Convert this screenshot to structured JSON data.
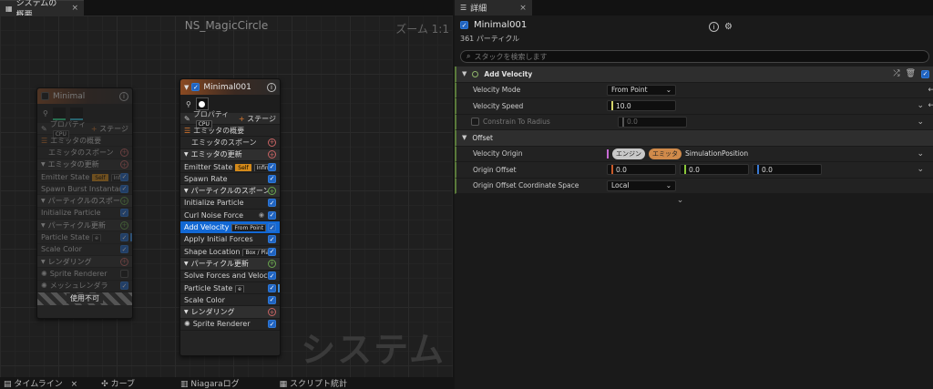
{
  "left_tab": {
    "label": "システムの概要",
    "close": "×"
  },
  "graph": {
    "title": "NS_MagicCircle",
    "zoom": "ズーム 1:1",
    "watermark": "システム"
  },
  "node_minimal": {
    "title": "Minimal",
    "info": "i",
    "props_label": "プロパティ",
    "cpu": "CPU",
    "stage": "ステージ",
    "rows": [
      {
        "label": "エミッタの概要",
        "kind": "summary"
      },
      {
        "label": "エミッタのスポーン",
        "kind": "sub"
      },
      {
        "label": "エミッタの更新",
        "kind": "section"
      },
      {
        "label": "Emitter State",
        "kind": "item",
        "badges": [
          "Self",
          "Infinite"
        ]
      },
      {
        "label": "Spawn Burst Instantaneous",
        "kind": "item"
      },
      {
        "label": "パーティクルのスポーン",
        "kind": "section"
      },
      {
        "label": "Initialize Particle",
        "kind": "item"
      },
      {
        "label": "パーティクル更新",
        "kind": "section"
      },
      {
        "label": "Particle State",
        "kind": "item",
        "badges": [
          "e"
        ]
      },
      {
        "label": "Scale Color",
        "kind": "item"
      },
      {
        "label": "レンダリング",
        "kind": "section"
      },
      {
        "label": "Sprite Renderer",
        "kind": "item"
      },
      {
        "label": "メッシュレンダラ",
        "kind": "item"
      }
    ],
    "footer": "使用不可"
  },
  "node_minimal001": {
    "title": "Minimal001",
    "info": "i",
    "props_label": "プロパティ",
    "cpu": "CPU",
    "stage": "ステージ",
    "rows": [
      {
        "label": "エミッタの概要",
        "kind": "summary"
      },
      {
        "label": "エミッタのスポーン",
        "kind": "sub"
      },
      {
        "label": "エミッタの更新",
        "kind": "section"
      },
      {
        "label": "Emitter State",
        "kind": "item",
        "badges": [
          "Self",
          "Infinite"
        ]
      },
      {
        "label": "Spawn Rate",
        "kind": "item"
      },
      {
        "label": "パーティクルのスポーン",
        "kind": "section"
      },
      {
        "label": "Initialize Particle",
        "kind": "item"
      },
      {
        "label": "Curl Noise Force",
        "kind": "item"
      },
      {
        "label": "Add Velocity",
        "kind": "item",
        "badges": [
          "From Point"
        ],
        "selected": true
      },
      {
        "label": "Apply Initial Forces",
        "kind": "item"
      },
      {
        "label": "Shape Location",
        "kind": "item",
        "badges": [
          "Box / Plane"
        ]
      },
      {
        "label": "パーティクル更新",
        "kind": "section"
      },
      {
        "label": "Solve Forces and Velocity",
        "kind": "item"
      },
      {
        "label": "Particle State",
        "kind": "item",
        "badges": [
          "e"
        ]
      },
      {
        "label": "Scale Color",
        "kind": "item"
      },
      {
        "label": "レンダリング",
        "kind": "section"
      },
      {
        "label": "Sprite Renderer",
        "kind": "item"
      }
    ]
  },
  "bottom_tabs": [
    "タイムライン",
    "カーブ",
    "Niagaraログ",
    "スクリプト統計"
  ],
  "details_tab": {
    "label": "詳細",
    "close": "×"
  },
  "details": {
    "name": "Minimal001",
    "particles": "361 パーティクル",
    "search_placeholder": "スタックを検索します",
    "section_title": "Add Velocity",
    "rows": {
      "velocity_mode": {
        "label": "Velocity Mode",
        "value": "From Point"
      },
      "velocity_speed": {
        "label": "Velocity Speed",
        "value": "10.0"
      },
      "constrain": {
        "label": "Constrain To Radius",
        "value": "0.0"
      },
      "offset_cat": {
        "label": "Offset"
      },
      "velocity_origin": {
        "label": "Velocity Origin",
        "pill1": "エンジン",
        "pill2": "エミッタ",
        "value": "SimulationPosition"
      },
      "origin_offset": {
        "label": "Origin Offset",
        "x": "0.0",
        "y": "0.0",
        "z": "0.0"
      },
      "coord_space": {
        "label": "Origin Offset Coordinate Space",
        "value": "Local"
      }
    }
  },
  "colors": {
    "accent": "#1268d4",
    "node_orange": "#8a4a22",
    "selected": "#1268d4"
  }
}
